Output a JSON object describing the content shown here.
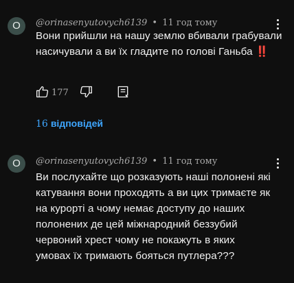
{
  "comments": [
    {
      "avatar_letter": "O",
      "author": "@orinasenyutovych6139",
      "separator": "•",
      "time": "11 год тому",
      "text": "Вони прийшли на нашу землю вбивали грабували насичували а ви їх гладите по голові Ганьба ‼️",
      "like_count": "177",
      "replies_count": "16",
      "replies_label": "відповідей"
    },
    {
      "avatar_letter": "O",
      "author": "@orinasenyutovych6139",
      "separator": "•",
      "time": "11 год тому",
      "text": "Ви послухайте що розказують наші полонені які катування вони проходять а ви цих тримаєте як на курорті  а чому немає доступу до наших полонених де цей міжнародний беззубий червоний хрест чому не покажуть в яких умовах їх тримають бояться путлера???"
    }
  ],
  "colors": {
    "background": "#0f0f0f",
    "text": "#f1f1f1",
    "secondary": "#aaaaaa",
    "link": "#3ea6ff"
  },
  "icons": [
    "thumb-up-icon",
    "thumb-down-icon",
    "reply-icon",
    "more-vert-icon"
  ]
}
